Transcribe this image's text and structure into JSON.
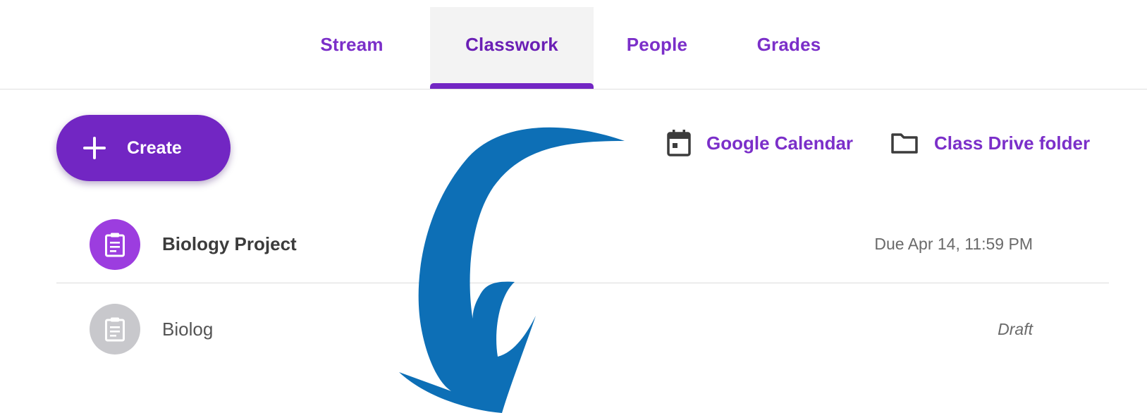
{
  "tabs": [
    {
      "label": "Stream",
      "active": false
    },
    {
      "label": "Classwork",
      "active": true
    },
    {
      "label": "People",
      "active": false
    },
    {
      "label": "Grades",
      "active": false
    }
  ],
  "actions": {
    "create_label": "Create",
    "calendar_label": "Google Calendar",
    "drive_label": "Class Drive folder"
  },
  "classwork": {
    "items": [
      {
        "title": "Biology Project",
        "meta": "Due Apr 14, 11:59 PM",
        "icon": "assignment-icon",
        "state": "published"
      },
      {
        "title": "Biolog",
        "meta": "Draft",
        "icon": "assignment-icon",
        "state": "draft"
      }
    ]
  },
  "colors": {
    "accent": "#7226c3",
    "link": "#7b2fc9",
    "assignment_icon_bg": "#9c3ddf",
    "draft_icon_bg": "#c8c8cc",
    "annotation_arrow": "#0d6fb6"
  },
  "icons": {
    "create": "plus-icon",
    "calendar": "calendar-icon",
    "drive": "folder-icon",
    "overlay": "curved-arrow-icon"
  }
}
